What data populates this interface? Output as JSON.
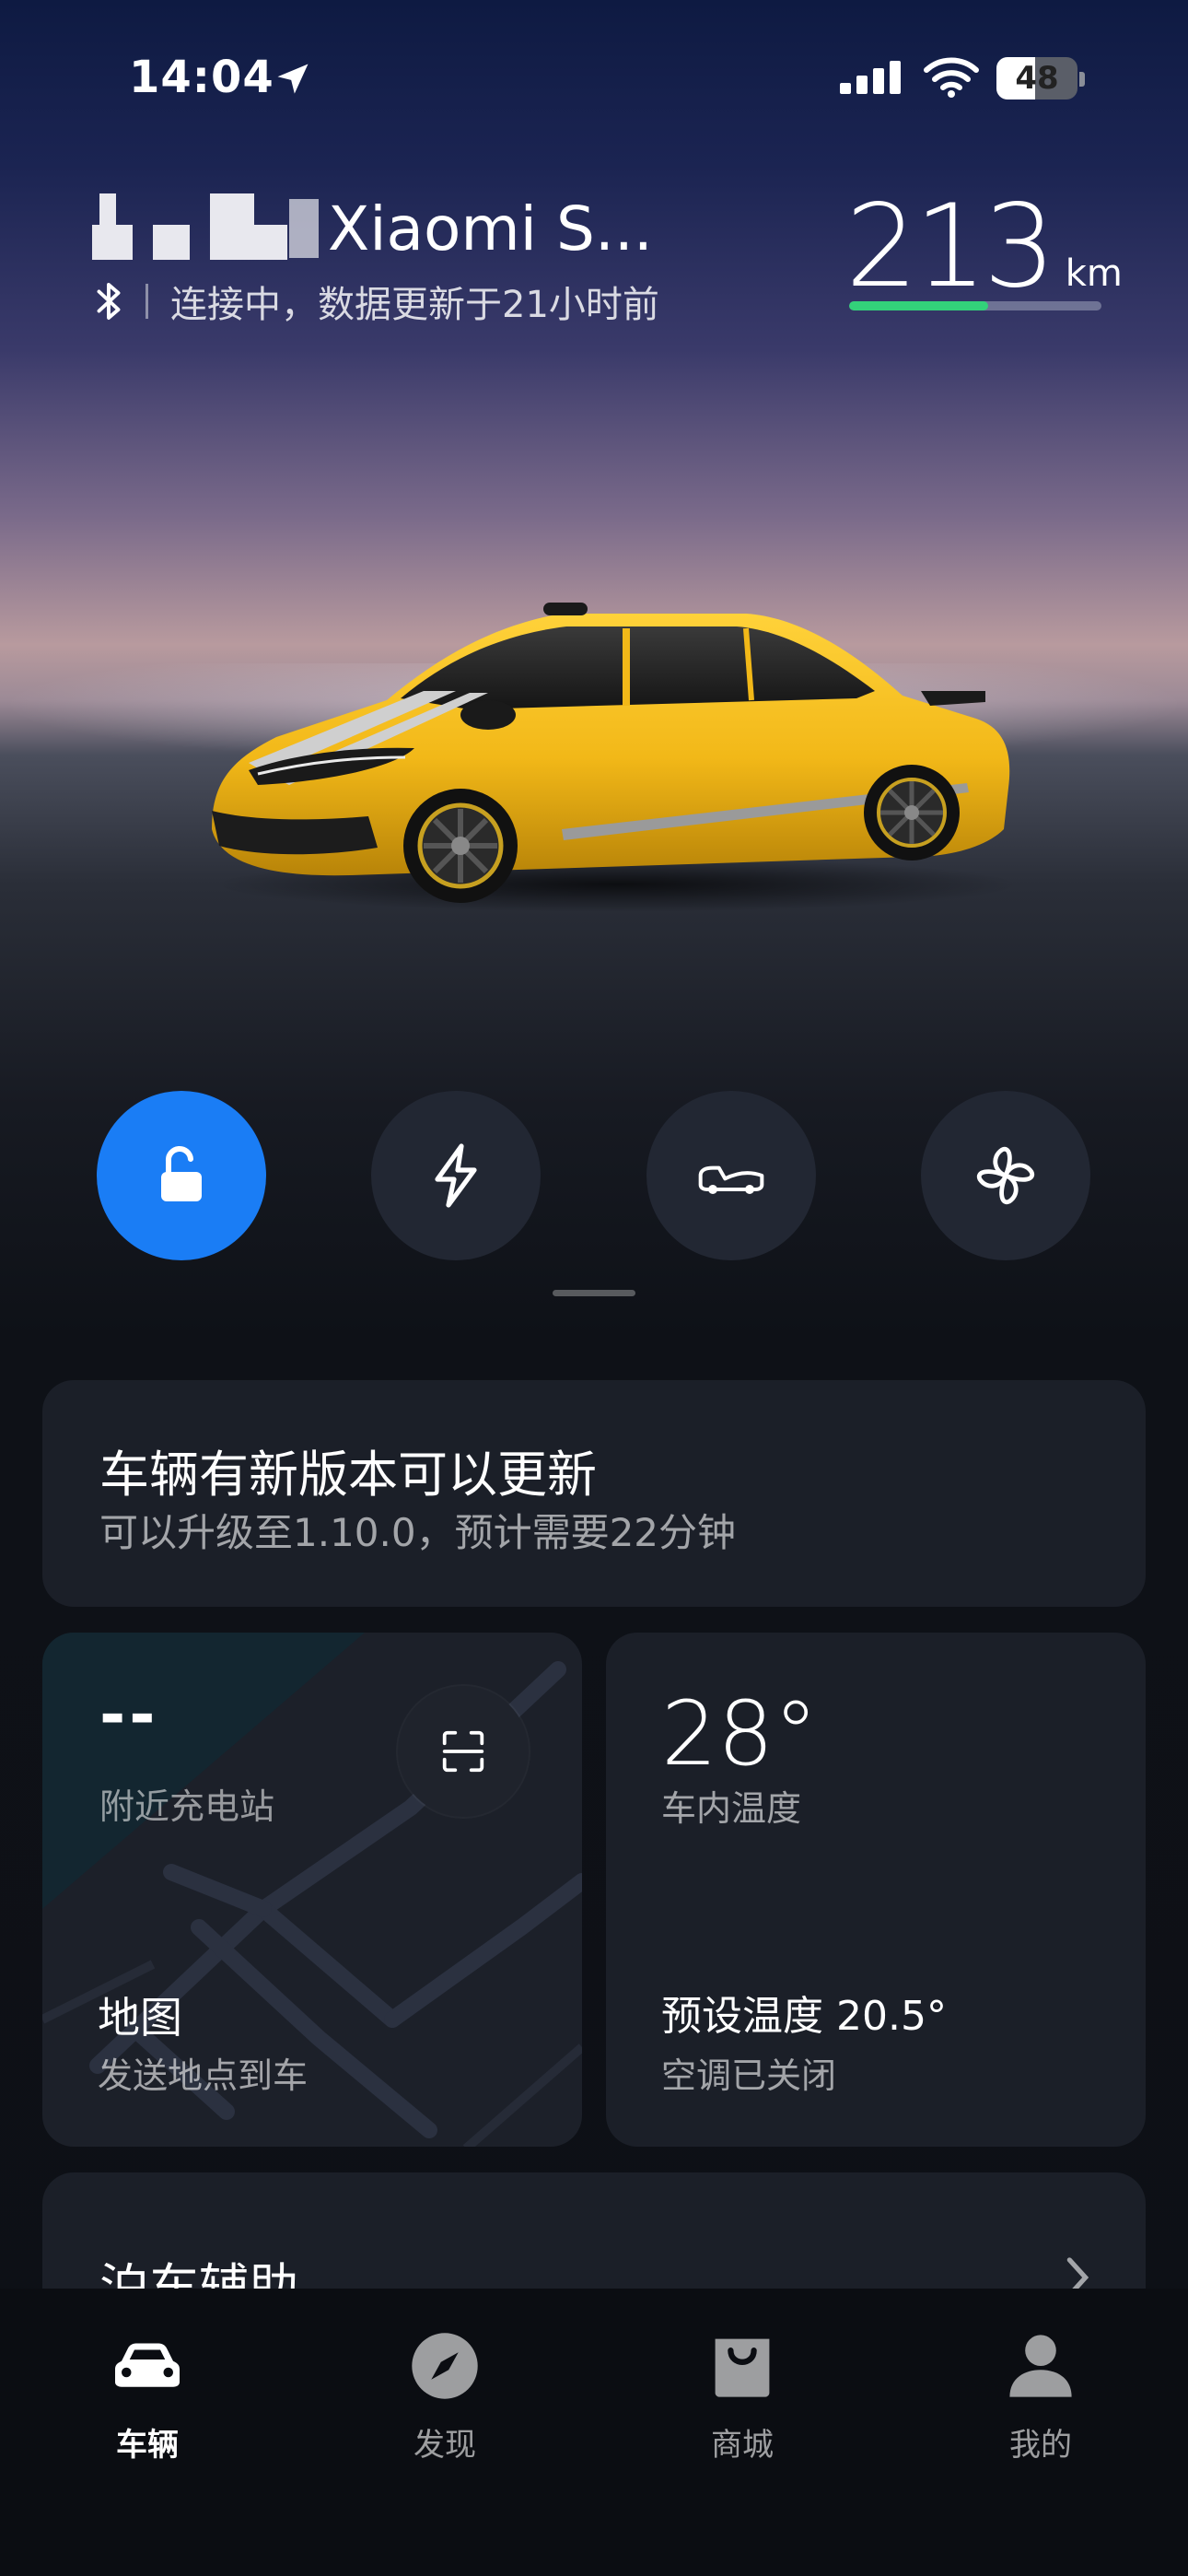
{
  "status_bar": {
    "time": "14:04",
    "battery_level": "48",
    "battery_fraction": 0.48
  },
  "header": {
    "car_name": "Xiaomi S...",
    "connection_status": "连接中，数据更新于21小时前",
    "range_value": "213",
    "range_unit": "km",
    "range_fraction": 0.55
  },
  "quick_actions": [
    {
      "name": "unlock",
      "icon": "unlock-icon",
      "active": true
    },
    {
      "name": "charge",
      "icon": "lightning-icon",
      "active": false
    },
    {
      "name": "trunk",
      "icon": "car-trunk-icon",
      "active": false
    },
    {
      "name": "climate",
      "icon": "fan-icon",
      "active": false
    }
  ],
  "update_card": {
    "title": "车辆有新版本可以更新",
    "subtitle": "可以升级至1.10.0，预计需要22分钟"
  },
  "map_card": {
    "station_value": "--",
    "station_label": "附近充电站",
    "title": "地图",
    "subtitle": "发送地点到车"
  },
  "temp_card": {
    "cabin_temp": "28°",
    "cabin_label": "车内温度",
    "preset_temp": "预设温度 20.5°",
    "ac_status": "空调已关闭"
  },
  "parking_card": {
    "title": "泊车辅助"
  },
  "tab_bar": {
    "tabs": [
      {
        "label": "车辆",
        "icon": "car-icon",
        "active": true
      },
      {
        "label": "发现",
        "icon": "compass-icon",
        "active": false
      },
      {
        "label": "商城",
        "icon": "shopping-bag-icon",
        "active": false
      },
      {
        "label": "我的",
        "icon": "person-icon",
        "active": false
      }
    ]
  },
  "colors": {
    "accent_blue": "#1a7df5",
    "range_green": "#33d17a",
    "car_yellow": "#f2b818"
  }
}
